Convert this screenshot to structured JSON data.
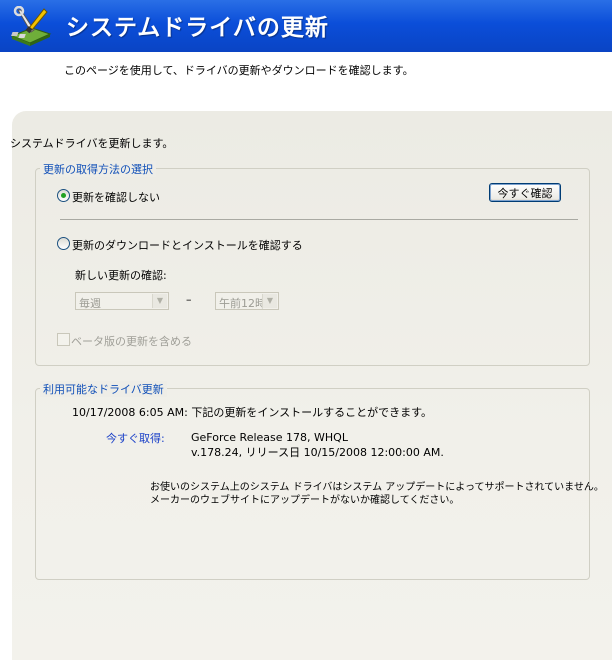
{
  "header": {
    "title": "システムドライバの更新"
  },
  "page": {
    "subtitle": "このページを使用して、ドライバの更新やダウンロードを確認します。",
    "intro": "システムドライバを更新します。"
  },
  "update_method": {
    "title": "更新の取得方法の選択",
    "option_no_check": "更新を確認しない",
    "option_download_install": "更新のダウンロードとインストールを確認する",
    "check_now_button": "今すぐ確認",
    "check_label": "新しい更新の確認:",
    "frequency_value": "毎週",
    "dash": "–",
    "time_value": "午前12時",
    "beta_label": "ベータ版の更新を含める",
    "selected_option": "option_no_check"
  },
  "available": {
    "title": "利用可能なドライバ更新",
    "status_line": "10/17/2008 6:05 AM: 下記の更新をインストールすることができます。",
    "get_now_label": "今すぐ取得:",
    "release_name": "GeForce Release 178, WHQL",
    "release_details": "v.178.24, リリース日 10/15/2008 12:00:00 AM.",
    "notice_line1": "お使いのシステム上のシステム ドライバはシステム アップデートによってサポートされていません。",
    "notice_line2": "メーカーのウェブサイトにアップデートがないか確認してください。"
  },
  "colors": {
    "header_blue": "#0b4ed9",
    "group_title_blue": "#1150b8",
    "link_blue": "#1a40c8",
    "radio_selected_green": "#21a121"
  },
  "icons": {
    "header": "wrench-screwdriver-board-icon"
  }
}
